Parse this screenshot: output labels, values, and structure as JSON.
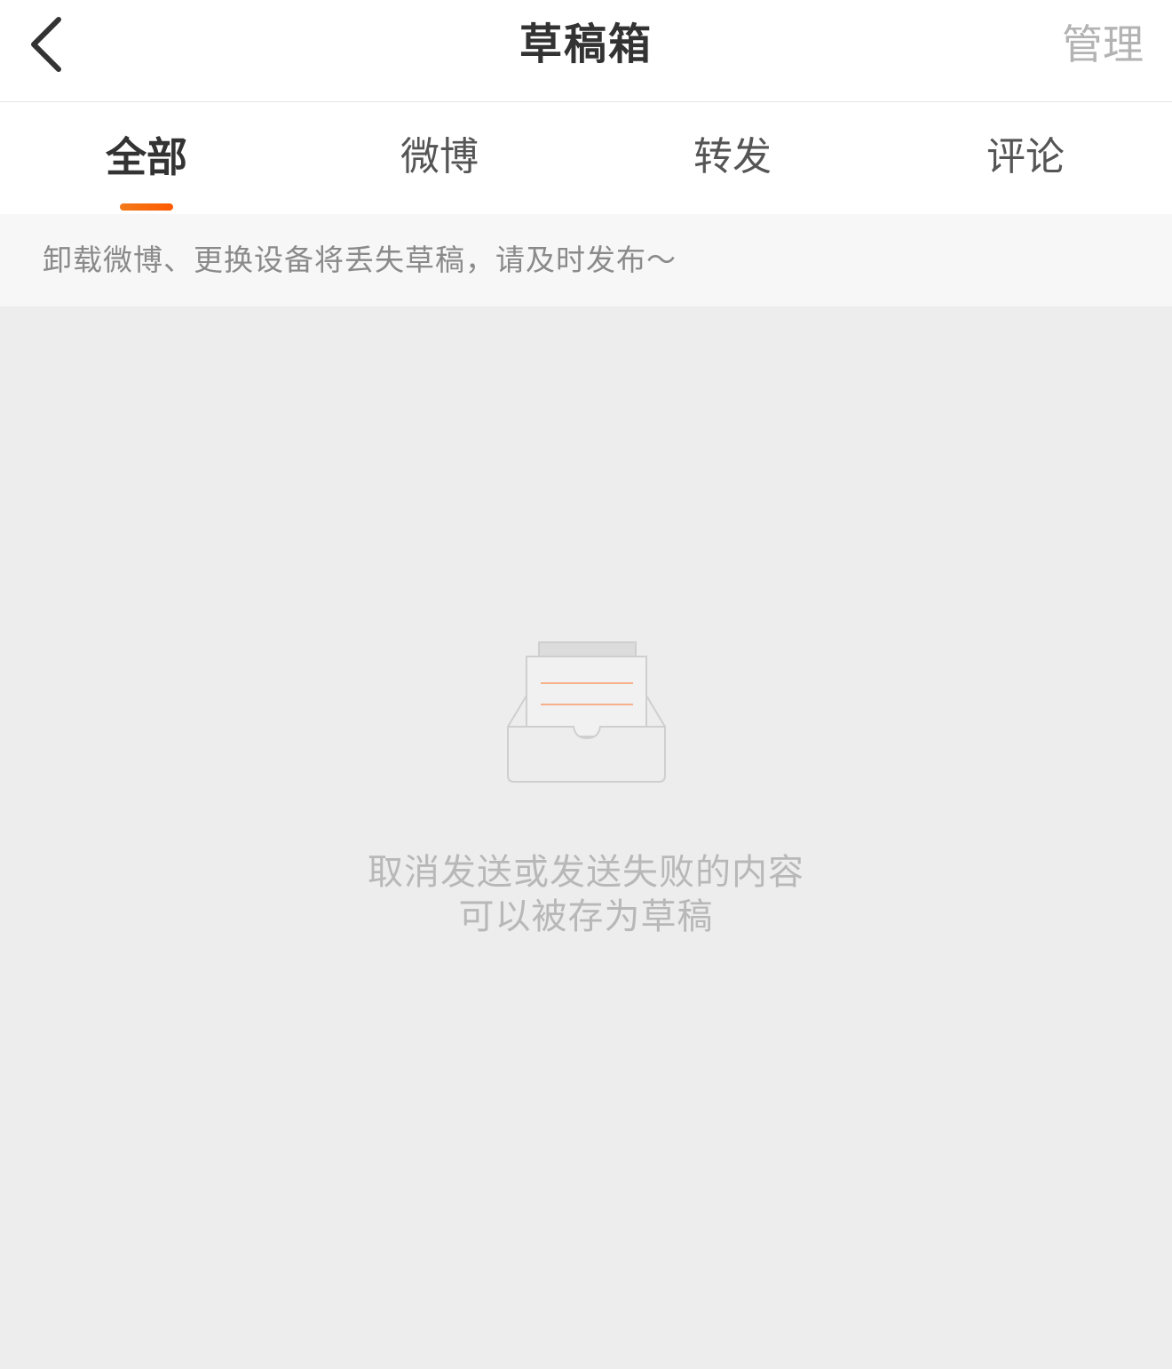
{
  "header": {
    "title": "草稿箱",
    "manage_label": "管理"
  },
  "tabs": [
    {
      "label": "全部",
      "active": true
    },
    {
      "label": "微博",
      "active": false
    },
    {
      "label": "转发",
      "active": false
    },
    {
      "label": "评论",
      "active": false
    }
  ],
  "notice": {
    "text": "卸载微博、更换设备将丢失草稿，请及时发布～"
  },
  "empty_state": {
    "icon": "draft-box-icon",
    "line1": "取消发送或发送失败的内容",
    "line2": "可以被存为草稿"
  },
  "colors": {
    "accent": "#ff6a00",
    "background": "#ededed",
    "muted_text": "#b8b8b8"
  }
}
